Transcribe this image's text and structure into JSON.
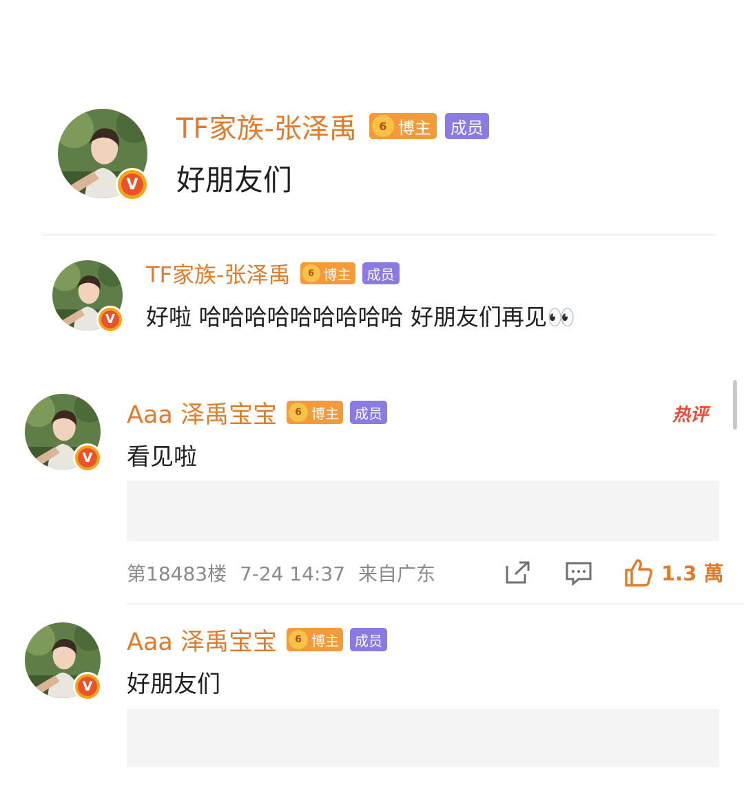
{
  "comments": [
    {
      "username": "TF家族-张泽禹",
      "boss_label": "博主",
      "member_label": "成员",
      "text": "好朋友们"
    },
    {
      "username": "TF家族-张泽禹",
      "boss_label": "博主",
      "member_label": "成员",
      "text": "好啦 哈哈哈哈哈哈哈哈哈 好朋友们再见",
      "emoji": "👀"
    },
    {
      "username": "Aaa 泽禹宝宝",
      "boss_label": "博主",
      "member_label": "成员",
      "text": "看见啦",
      "hot_label": "热评",
      "floor": "第18483楼",
      "time": "7-24 14:37",
      "location": "来自广东",
      "likes": "1.3 萬"
    },
    {
      "username": "Aaa 泽禹宝宝",
      "boss_label": "博主",
      "member_label": "成员",
      "text": "好朋友们"
    }
  ],
  "icons": {
    "verified": "V",
    "share": "share-icon",
    "comment": "comment-icon",
    "like": "thumbs-up-icon",
    "crown_digit": "6"
  },
  "colors": {
    "username": "#e07b2c",
    "boss_badge": "#f39b3a",
    "member_badge": "#8a7be3",
    "hot": "#e94a35",
    "verified": "#e8532c"
  }
}
